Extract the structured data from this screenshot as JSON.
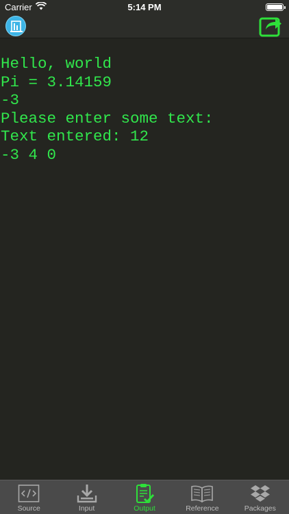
{
  "status_bar": {
    "carrier": "Carrier",
    "time": "5:14 PM"
  },
  "nav_bar": {
    "logo_icon": "app-logo-icon",
    "share_icon": "share-icon"
  },
  "console": {
    "text_color": "#31e64c",
    "background": "#242520",
    "lines": [
      "Hello, world",
      "Pi = 3.14159",
      "-3",
      "Please enter some text:",
      "Text entered: 12",
      "-3 4 0"
    ]
  },
  "tab_bar": {
    "active_color": "#2ee03a",
    "tabs": [
      {
        "label": "Source",
        "icon": "code-icon"
      },
      {
        "label": "Input",
        "icon": "download-icon"
      },
      {
        "label": "Output",
        "icon": "clipboard-check-icon",
        "active": true
      },
      {
        "label": "Reference",
        "icon": "book-icon"
      },
      {
        "label": "Packages",
        "icon": "dropbox-icon"
      }
    ]
  }
}
